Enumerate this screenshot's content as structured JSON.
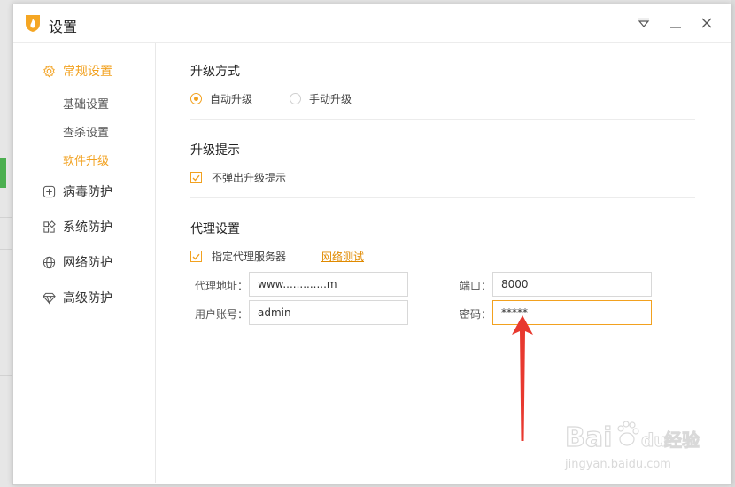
{
  "window": {
    "title": "设置"
  },
  "titlebar": {
    "menu_icon": "dropdown-menu-icon",
    "minimize_icon": "minimize-icon",
    "close_icon": "close-icon"
  },
  "sidebar": {
    "items": [
      {
        "label": "常规设置",
        "icon": "gear-icon",
        "active": true
      },
      {
        "label": "病毒防护",
        "icon": "plus-square-icon"
      },
      {
        "label": "系统防护",
        "icon": "grid-icon"
      },
      {
        "label": "网络防护",
        "icon": "globe-icon"
      },
      {
        "label": "高级防护",
        "icon": "diamond-icon"
      }
    ],
    "sub_items": [
      {
        "label": "基础设置"
      },
      {
        "label": "查杀设置"
      },
      {
        "label": "软件升级",
        "active": true
      }
    ]
  },
  "upgrade_method": {
    "title": "升级方式",
    "auto_label": "自动升级",
    "manual_label": "手动升级",
    "selected": "auto"
  },
  "upgrade_prompt": {
    "title": "升级提示",
    "no_popup_label": "不弹出升级提示",
    "checked": true
  },
  "proxy": {
    "title": "代理设置",
    "use_proxy_label": "指定代理服务器",
    "checked": true,
    "test_link": "网络测试",
    "address_label": "代理地址：",
    "address_value": "www.............m",
    "port_label": "端口：",
    "port_value": "8000",
    "account_label": "用户账号：",
    "account_value": "admin",
    "password_label": "密码：",
    "password_value": "*****"
  },
  "colors": {
    "accent": "#f2a11f",
    "annotation_arrow": "#e8392f"
  },
  "watermark": {
    "brand": "Baidu经验",
    "url": "jingyan.baidu.com"
  }
}
